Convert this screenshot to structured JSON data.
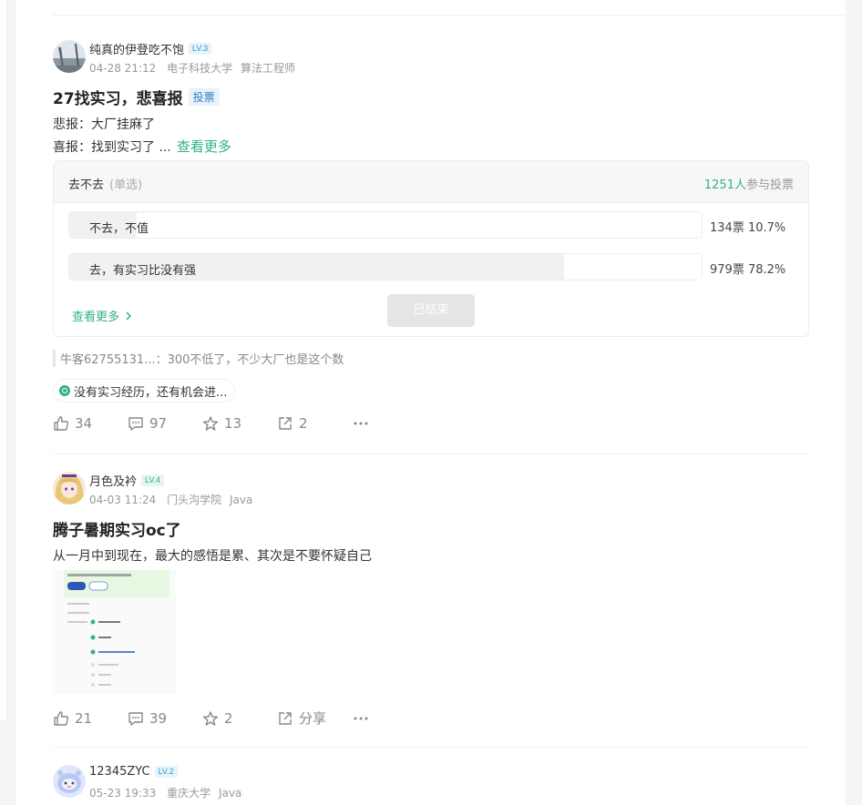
{
  "posts": [
    {
      "username": "纯真的伊登吃不饱",
      "level": "LV.3",
      "date": "04-28 21:12",
      "school": "电子科技大学",
      "role": "算法工程师",
      "title": "27找实习，悲喜报",
      "tag": "投票",
      "body_line1": "悲报：大厂挂麻了",
      "body_line2": "喜报：找到实习了 ...",
      "more_label": "查看更多",
      "poll": {
        "question": "去不去",
        "mode": "(单选)",
        "participants": "1251人",
        "participants_suffix": "参与投票",
        "options": [
          {
            "label": "不去，不值",
            "votes": "134票",
            "percent": "10.7%",
            "share": 0.107
          },
          {
            "label": "去，有实习比没有强",
            "votes": "979票",
            "percent": "78.2%",
            "share": 0.782
          }
        ],
        "view_more": "查看更多",
        "ended_label": "已结束"
      },
      "comment": "牛客62755131...：300不低了，不少大厂也是这个数",
      "topic": "没有实习经历，还有机会进...",
      "likes": "34",
      "comments": "97",
      "stars": "13",
      "shares": "2"
    },
    {
      "username": "月色及衿",
      "level": "LV.4",
      "date": "04-03 11:24",
      "school": "门头沟学院",
      "role": "Java",
      "title": "腾子暑期实习oc了",
      "body_line1": "从一月中到现在，最大的感悟是累、其次是不要怀疑自己",
      "likes": "21",
      "comments": "39",
      "stars": "2",
      "shares": "分享"
    },
    {
      "username": "12345ZYC",
      "level": "LV.2",
      "date": "05-23 19:33",
      "school": "重庆大学",
      "role": "Java"
    }
  ],
  "colors": {
    "accent": "#32b08a",
    "muted": "#999999"
  }
}
